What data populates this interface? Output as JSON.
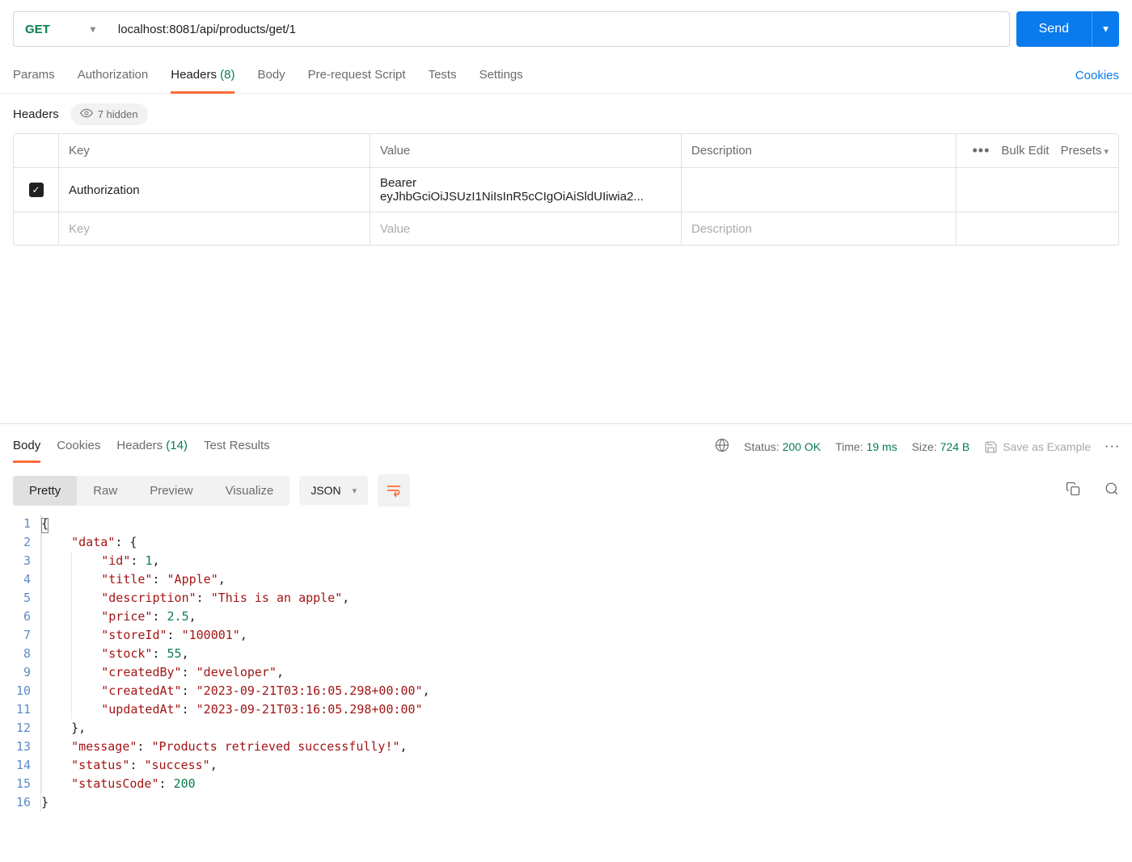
{
  "request": {
    "method": "GET",
    "url": "localhost:8081/api/products/get/1",
    "sendLabel": "Send"
  },
  "tabs": {
    "params": "Params",
    "authorization": "Authorization",
    "headers": "Headers",
    "headersCount": "(8)",
    "body": "Body",
    "prereq": "Pre-request Script",
    "tests": "Tests",
    "settings": "Settings",
    "cookies": "Cookies"
  },
  "headersPanel": {
    "title": "Headers",
    "hidden": "7 hidden",
    "colKey": "Key",
    "colValue": "Value",
    "colDesc": "Description",
    "bulkEdit": "Bulk Edit",
    "presets": "Presets",
    "rows": [
      {
        "key": "Authorization",
        "value": "Bearer eyJhbGciOiJSUzI1NiIsInR5cCIgOiAiSldUIiwia2..."
      }
    ],
    "placeholderKey": "Key",
    "placeholderValue": "Value",
    "placeholderDesc": "Description"
  },
  "responseTabs": {
    "body": "Body",
    "cookies": "Cookies",
    "headers": "Headers",
    "headersCount": "(14)",
    "testResults": "Test Results"
  },
  "responseMeta": {
    "statusLabel": "Status:",
    "statusValue": "200 OK",
    "timeLabel": "Time:",
    "timeValue": "19 ms",
    "sizeLabel": "Size:",
    "sizeValue": "724 B",
    "saveExample": "Save as Example"
  },
  "format": {
    "pretty": "Pretty",
    "raw": "Raw",
    "preview": "Preview",
    "visualize": "Visualize",
    "lang": "JSON"
  },
  "responseBody": {
    "data": {
      "id": 1,
      "title": "Apple",
      "description": "This is an apple",
      "price": 2.5,
      "storeId": "100001",
      "stock": 55,
      "createdBy": "developer",
      "createdAt": "2023-09-21T03:16:05.298+00:00",
      "updatedAt": "2023-09-21T03:16:05.298+00:00"
    },
    "message": "Products retrieved successfully!",
    "status": "success",
    "statusCode": 200
  }
}
